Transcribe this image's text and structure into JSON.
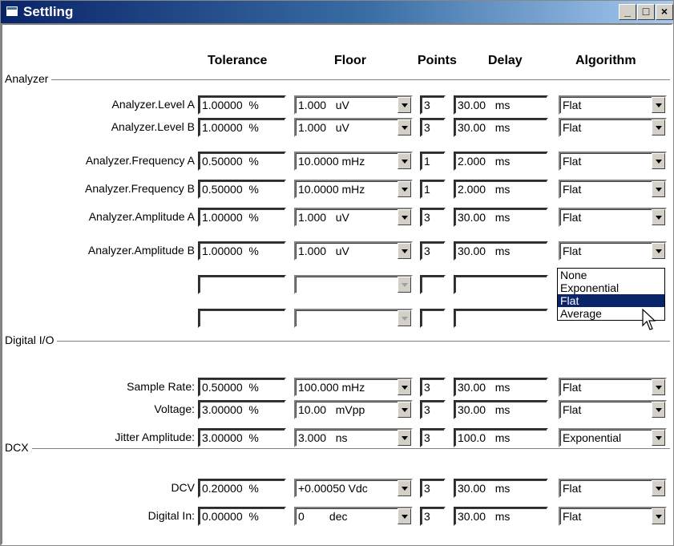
{
  "window": {
    "title": "Settling"
  },
  "columns": {
    "tolerance": "Tolerance",
    "floor": "Floor",
    "points": "Points",
    "delay": "Delay",
    "algorithm": "Algorithm"
  },
  "groups": {
    "analyzer": "Analyzer",
    "digital_io": "Digital I/O",
    "dcx": "DCX"
  },
  "rows": [
    {
      "label": "Analyzer.Level A",
      "tolerance": "1.00000  %",
      "floor": "1.000   uV",
      "points": "3",
      "delay": "30.00   ms",
      "algorithm": "Flat"
    },
    {
      "label": "Analyzer.Level B",
      "tolerance": "1.00000  %",
      "floor": "1.000   uV",
      "points": "3",
      "delay": "30.00   ms",
      "algorithm": "Flat"
    },
    {
      "label": "Analyzer.Frequency A",
      "tolerance": "0.50000  %",
      "floor": "10.0000 mHz",
      "points": "1",
      "delay": "2.000   ms",
      "algorithm": "Flat"
    },
    {
      "label": "Analyzer.Frequency B",
      "tolerance": "0.50000  %",
      "floor": "10.0000 mHz",
      "points": "1",
      "delay": "2.000   ms",
      "algorithm": "Flat"
    },
    {
      "label": "Analyzer.Amplitude A",
      "tolerance": "1.00000  %",
      "floor": "1.000   uV",
      "points": "3",
      "delay": "30.00   ms",
      "algorithm": "Flat"
    },
    {
      "label": "Analyzer.Amplitude B",
      "tolerance": "1.00000  %",
      "floor": "1.000   uV",
      "points": "3",
      "delay": "30.00   ms",
      "algorithm": "Flat"
    },
    {
      "label": "Sample Rate:",
      "tolerance": "0.50000  %",
      "floor": "100.000 mHz",
      "points": "3",
      "delay": "30.00   ms",
      "algorithm": "Flat"
    },
    {
      "label": "Voltage:",
      "tolerance": "3.00000  %",
      "floor": "10.00   mVpp",
      "points": "3",
      "delay": "30.00   ms",
      "algorithm": "Flat"
    },
    {
      "label": "Jitter Amplitude:",
      "tolerance": "3.00000  %",
      "floor": "3.000   ns",
      "points": "3",
      "delay": "100.0   ms",
      "algorithm": "Exponential"
    },
    {
      "label": "DCV",
      "tolerance": "0.20000  %",
      "floor": "+0.00050 Vdc",
      "points": "3",
      "delay": "30.00   ms",
      "algorithm": "Flat"
    },
    {
      "label": "Digital In:",
      "tolerance": "0.00000  %",
      "floor": "0        dec",
      "points": "3",
      "delay": "30.00   ms",
      "algorithm": "Flat"
    }
  ],
  "dropdown": {
    "options": [
      "None",
      "Exponential",
      "Flat",
      "Average"
    ],
    "selected": "Flat"
  },
  "titlebar_buttons": {
    "minimize": "_",
    "maximize": "□",
    "close": "×"
  }
}
